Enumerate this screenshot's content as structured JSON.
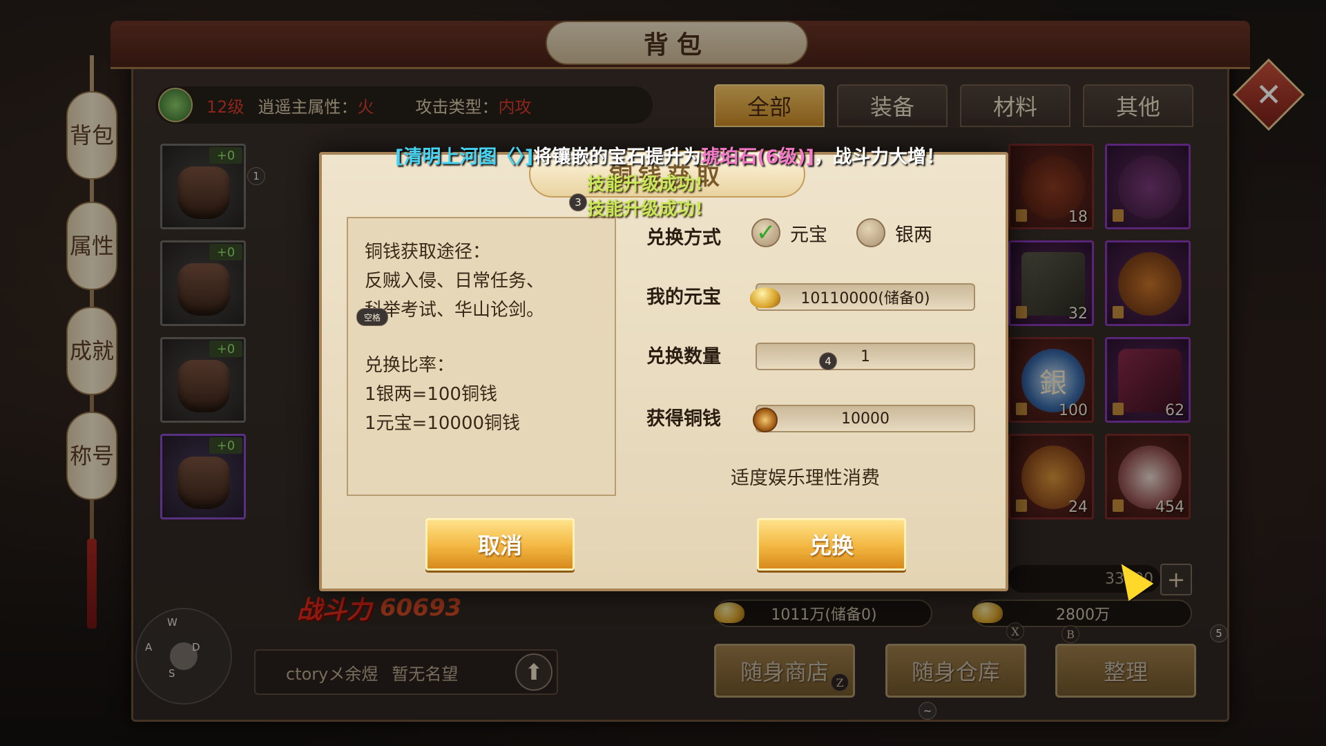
{
  "window_title": "背包",
  "side_tabs": [
    "背包",
    "属性",
    "成就",
    "称号"
  ],
  "info_bar": {
    "level": "12级",
    "attribute_label": "逍遥主属性：",
    "attribute_value": "火",
    "attack_label": "攻击类型：",
    "attack_value": "内攻"
  },
  "category_tabs": [
    {
      "label": "全部",
      "active": true
    },
    {
      "label": "装备",
      "active": false
    },
    {
      "label": "材料",
      "active": false
    },
    {
      "label": "其他",
      "active": false
    }
  ],
  "equipment": [
    {
      "plus": "+0",
      "rarity": "gray",
      "badge": "1"
    },
    {
      "plus": "+0",
      "rarity": "gray",
      "badge": ""
    },
    {
      "plus": "+0",
      "rarity": "gray",
      "badge": ""
    },
    {
      "plus": "+0",
      "rarity": "purple",
      "badge": ""
    }
  ],
  "inventory": [
    {
      "count": "18",
      "rarity": "red"
    },
    {
      "count": "",
      "rarity": "purple"
    },
    {
      "count": "32",
      "rarity": "purple"
    },
    {
      "count": "",
      "rarity": "purple"
    },
    {
      "count": "100",
      "rarity": "red",
      "glyph": "銀"
    },
    {
      "count": "62",
      "rarity": "purple"
    },
    {
      "count": "24",
      "rarity": "red"
    },
    {
      "count": "454",
      "rarity": "red"
    }
  ],
  "broadcast": {
    "part1": "[清明上河图〈〉]",
    "part2": "将镶嵌的宝石提升为",
    "part3": "琥珀石(6级)]",
    "part4": "，战斗力大增！"
  },
  "toasts": [
    "技能升级成功!",
    "技能升级成功!"
  ],
  "dialog": {
    "title": "铜钱获取",
    "info_lines": [
      "铜钱获取途径：",
      "反贼入侵、日常任务、",
      "科举考试、华山论剑。"
    ],
    "rate_title": "兑换比率：",
    "rate_lines": [
      "1银两=100铜钱",
      "1元宝=10000铜钱"
    ],
    "method_label": "兑换方式",
    "method_options": [
      {
        "label": "元宝",
        "checked": true
      },
      {
        "label": "银两",
        "checked": false
      }
    ],
    "my_yuanbao_label": "我的元宝",
    "my_yuanbao_value": "10110000(储备0)",
    "quantity_label": "兑换数量",
    "quantity_value": "1",
    "earn_label": "获得铜钱",
    "earn_value": "10000",
    "notice": "适度娱乐理性消费",
    "cancel_label": "取消",
    "confirm_label": "兑换",
    "quantity_hint": "4",
    "title_hint": "3"
  },
  "currency": {
    "silver_line": "33300",
    "gold": "1011万(储备0)",
    "bound_gold": "2800万"
  },
  "combat": {
    "label": "战斗力",
    "value": "60693"
  },
  "player": {
    "name": "ctoryメ余煜",
    "prestige": "暂无名望"
  },
  "action_buttons": [
    {
      "label": "随身商店",
      "key": "Z"
    },
    {
      "label": "随身仓库",
      "key": "X"
    },
    {
      "label": "整理",
      "key": "B"
    }
  ],
  "joystick_keys": {
    "up": "W",
    "left": "A",
    "right": "D",
    "down": "S"
  },
  "key_hints": {
    "top_right": "5",
    "bottom_center": "~",
    "small_label": "空格"
  },
  "colors": {
    "accent_gold": "#f3b640",
    "danger_red": "#d83a2a",
    "broadcast_cyan": "#46d4f4",
    "toast_green": "#c8e85a"
  }
}
